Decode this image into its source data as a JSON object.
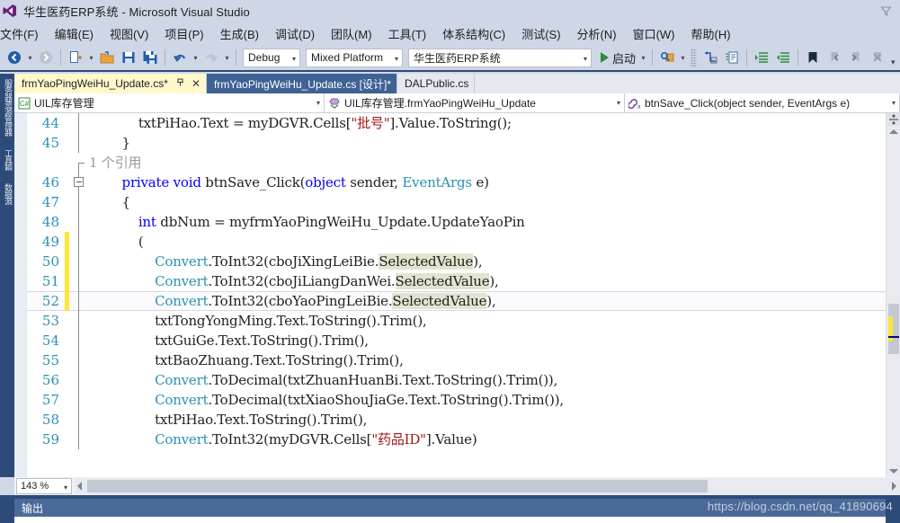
{
  "window": {
    "title": "华生医药ERP系统 - Microsoft Visual Studio",
    "logo_icon": "visual-studio-logo",
    "corner_icon": "filter-triangle-icon"
  },
  "menubar": {
    "items": [
      {
        "label": "文件(F)"
      },
      {
        "label": "编辑(E)"
      },
      {
        "label": "视图(V)"
      },
      {
        "label": "项目(P)"
      },
      {
        "label": "生成(B)"
      },
      {
        "label": "调试(D)"
      },
      {
        "label": "团队(M)"
      },
      {
        "label": "工具(T)"
      },
      {
        "label": "体系结构(C)"
      },
      {
        "label": "测试(S)"
      },
      {
        "label": "分析(N)"
      },
      {
        "label": "窗口(W)"
      },
      {
        "label": "帮助(H)"
      }
    ]
  },
  "toolbar": {
    "nav_back_icon": "navigate-back-icon",
    "nav_forward_icon": "navigate-forward-icon",
    "new_item_icon": "new-item-icon",
    "open_file_icon": "open-file-icon",
    "save_icon": "save-icon",
    "save_all_icon": "save-all-icon",
    "undo_icon": "undo-icon",
    "redo_icon": "redo-icon",
    "config_value": "Debug",
    "platform_value": "Mixed Platform",
    "project_value": "华生医药ERP系统",
    "start_label": "启动",
    "start_icon": "play-icon",
    "find_icon": "find-in-files-icon",
    "step_icon": "step-into-icon",
    "comment_icon": "comment-selection-icon",
    "uncomment_icon": "uncomment-selection-icon",
    "indent_icon": "increase-indent-icon",
    "outdent_icon": "decrease-indent-icon",
    "bookmark_icon": "bookmark-icon",
    "prev_bookmark_icon": "previous-bookmark-icon",
    "next_bookmark_icon": "next-bookmark-icon",
    "clear_bookmark_icon": "clear-bookmarks-icon",
    "overflow_icon": "toolbar-overflow-icon"
  },
  "leftdock": {
    "tabs": [
      {
        "label": "服务器资源管理器"
      },
      {
        "label": "工具箱"
      },
      {
        "label": "数据源"
      }
    ]
  },
  "tabs": [
    {
      "label": "frmYaoPingWeiHu_Update.cs*",
      "state": "active",
      "pin": "📌",
      "close": "✕"
    },
    {
      "label": "frmYaoPingWeiHu_Update.cs [设计]*",
      "state": "selected-bg"
    },
    {
      "label": "DALPublic.cs",
      "state": "plain"
    }
  ],
  "navbar": {
    "project": {
      "icon": "csharp-project-icon",
      "label": "UIL库存管理"
    },
    "type": {
      "icon": "class-icon",
      "label": "UIL库存管理.frmYaoPingWeiHu_Update"
    },
    "member": {
      "icon": "method-icon",
      "label": "btnSave_Click(object sender, EventArgs e)"
    }
  },
  "editor": {
    "codelens_text": "1 个引用",
    "lines": [
      {
        "no": "44",
        "changed": false
      },
      {
        "no": "45",
        "changed": false
      },
      {
        "no": "46",
        "changed": false
      },
      {
        "no": "47",
        "changed": false
      },
      {
        "no": "48",
        "changed": false
      },
      {
        "no": "49",
        "changed": true
      },
      {
        "no": "50",
        "changed": true
      },
      {
        "no": "51",
        "changed": true
      },
      {
        "no": "52",
        "changed": true
      },
      {
        "no": "53",
        "changed": false
      },
      {
        "no": "54",
        "changed": false
      },
      {
        "no": "55",
        "changed": false
      },
      {
        "no": "56",
        "changed": false
      },
      {
        "no": "57",
        "changed": false
      },
      {
        "no": "58",
        "changed": false
      },
      {
        "no": "59",
        "changed": false
      }
    ],
    "code": {
      "l44": "            txtPiHao.Text = myDGVR.Cells[",
      "l44_str": "\"批号\"",
      "l44b": "].Value.ToString();",
      "l45": "        }",
      "l46_k1": "private",
      "l46_k2": "void",
      "l46_rest": " btnSave_Click(",
      "l46_k3": "object",
      "l46_rest2": " sender, ",
      "l46_k4": "EventArgs",
      "l46_rest3": " e)",
      "l47": "        {",
      "l48_k": "int",
      "l48_rest": " dbNum = myfrmYaoPingWeiHu_Update.UpdateYaoPin",
      "l49": "            (",
      "l50_conv": "Convert",
      "l50_mid": ".ToInt32(cboJiXingLeiBie.",
      "l50_hl": "SelectedValue",
      "l50_end": "),",
      "l51_mid": ".ToInt32(cboJiLiangDanWei.",
      "l51_hl": "SelectedValue",
      "l51_end": "),",
      "l52_mid": ".ToInt32(cboYaoPingLeiBie.",
      "l52_hl": "SelectedValue",
      "l52_end": "),",
      "l53": "                txtTongYongMing.Text.ToString().Trim(),",
      "l54": "                txtGuiGe.Text.ToString().Trim(),",
      "l55": "                txtBaoZhuang.Text.ToString().Trim(),",
      "l56_mid": ".ToDecimal(txtZhuanHuanBi.Text.ToString().Trim()),",
      "l57_mid": ".ToDecimal(txtXiaoShouJiaGe.Text.ToString().Trim()),",
      "l58": "                txtPiHao.Text.ToString().Trim(),",
      "l59_mid": ".ToInt32(myDGVR.Cells[",
      "l59_str": "\"药品ID\"",
      "l59_end": "].Value)"
    },
    "scrollbar": {
      "split_icon": "split-view-icon",
      "up_icon": "scroll-up-icon",
      "down_icon": "scroll-down-icon"
    }
  },
  "statusstrip": {
    "zoom_value": "143 %",
    "hscroll_left_icon": "scroll-left-icon",
    "hscroll_right_icon": "scroll-right-icon"
  },
  "output": {
    "title": "输出"
  },
  "watermark": {
    "text": "https://blog.csdn.net/qq_41890694"
  },
  "colors": {
    "chrome": "#cfd6e6",
    "accent_dark": "#2d4b78",
    "tab_active": "#fff8cc",
    "keyword": "#0000ff",
    "type": "#2b91af",
    "string": "#a31515",
    "codelens": "#9a9a9a",
    "change_bar": "#ffe538",
    "highlight": "#e3e4cf"
  }
}
